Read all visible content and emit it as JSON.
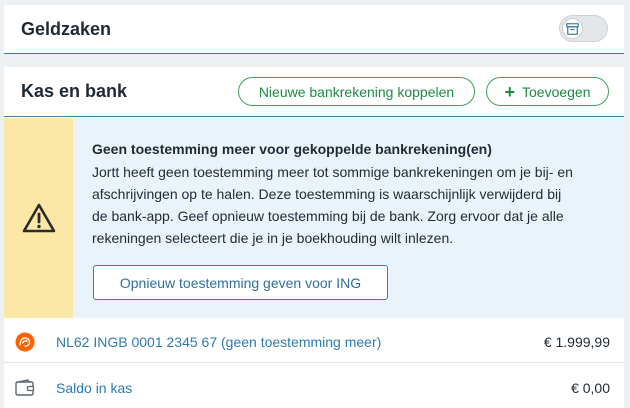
{
  "header": {
    "title": "Geldzaken",
    "archive_toggle": {
      "icon": "archive-icon",
      "state": "off"
    }
  },
  "kas_en_bank": {
    "title": "Kas en bank",
    "buttons": {
      "koppelen": "Nieuwe bankrekening koppelen",
      "toevoegen": "Toevoegen"
    },
    "alert": {
      "icon": "warning-icon",
      "title": "Geen toestemming meer voor gekoppelde bankrekening(en)",
      "lines": [
        "Jortt heeft geen toestemming meer tot sommige bankrekeningen om je bij- en",
        "afschrijvingen op te halen. Deze toestemming is waarschijnlijk verwijderd bij",
        "de bank-app. Geef opnieuw toestemming bij de bank. Zorg ervoor dat je alle",
        "rekeningen selecteert die je in je boekhouding wilt inlezen."
      ],
      "action": "Opnieuw toestemming geven voor ING"
    },
    "accounts": [
      {
        "icon": "ing-lion-icon",
        "label": "NL62 INGB 0001 2345 67 (geen toestemming meer)",
        "amount": "€ 1.999,99"
      },
      {
        "icon": "wallet-icon",
        "label": "Saldo in kas",
        "amount": "€ 0,00"
      }
    ]
  },
  "colors": {
    "accent_green": "#3aa55c",
    "link_blue": "#2f7ab0",
    "alert_bg": "#e9f3fb",
    "warning_yellow": "#fbe7a6",
    "ing_orange": "#ff6200"
  }
}
